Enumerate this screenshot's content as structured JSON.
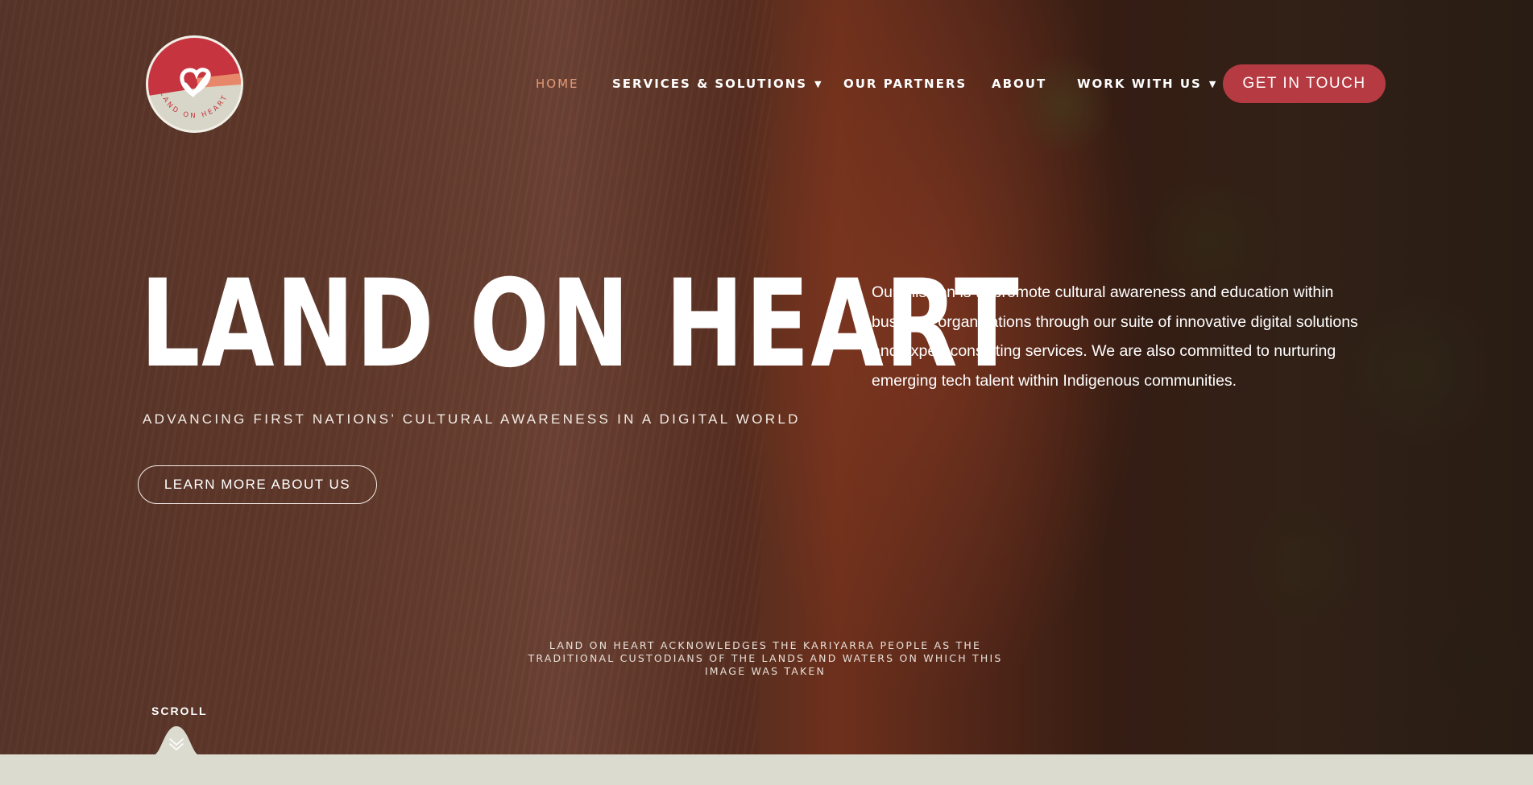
{
  "brand": {
    "logo_text": "LAND ON HEART",
    "colors": {
      "accent": "#b63a42",
      "active_nav": "#e49a78",
      "logo_bg": "#d7d6c8",
      "band": "#dcdbd0"
    }
  },
  "nav": {
    "items": [
      {
        "label": "HOME",
        "active": true
      },
      {
        "label": "SERVICES & SOLUTIONS",
        "dropdown": true
      },
      {
        "label": "OUR PARTNERS"
      },
      {
        "label": "ABOUT"
      },
      {
        "label": "WORK WITH US",
        "dropdown": true
      }
    ],
    "cta_label": "GET IN TOUCH"
  },
  "hero": {
    "title": "LAND ON HEART",
    "tagline": "ADVANCING FIRST NATIONS’ CULTURAL AWARENESS IN A DIGITAL WORLD",
    "button_label": "LEARN MORE ABOUT US",
    "mission": "Our mission is to promote cultural awareness and education within business organisations through our suite of innovative digital solutions and expert consulting services. We are also committed to nurturing emerging tech talent within Indigenous communities.",
    "acknowledgement": "LAND ON HEART ACKNOWLEDGES THE KARIYARRA PEOPLE AS THE TRADITIONAL CUSTODIANS OF THE LANDS AND WATERS ON WHICH THIS IMAGE WAS TAKEN"
  },
  "scroll": {
    "label": "SCROLL",
    "icon": "chevron-double-down-icon"
  }
}
